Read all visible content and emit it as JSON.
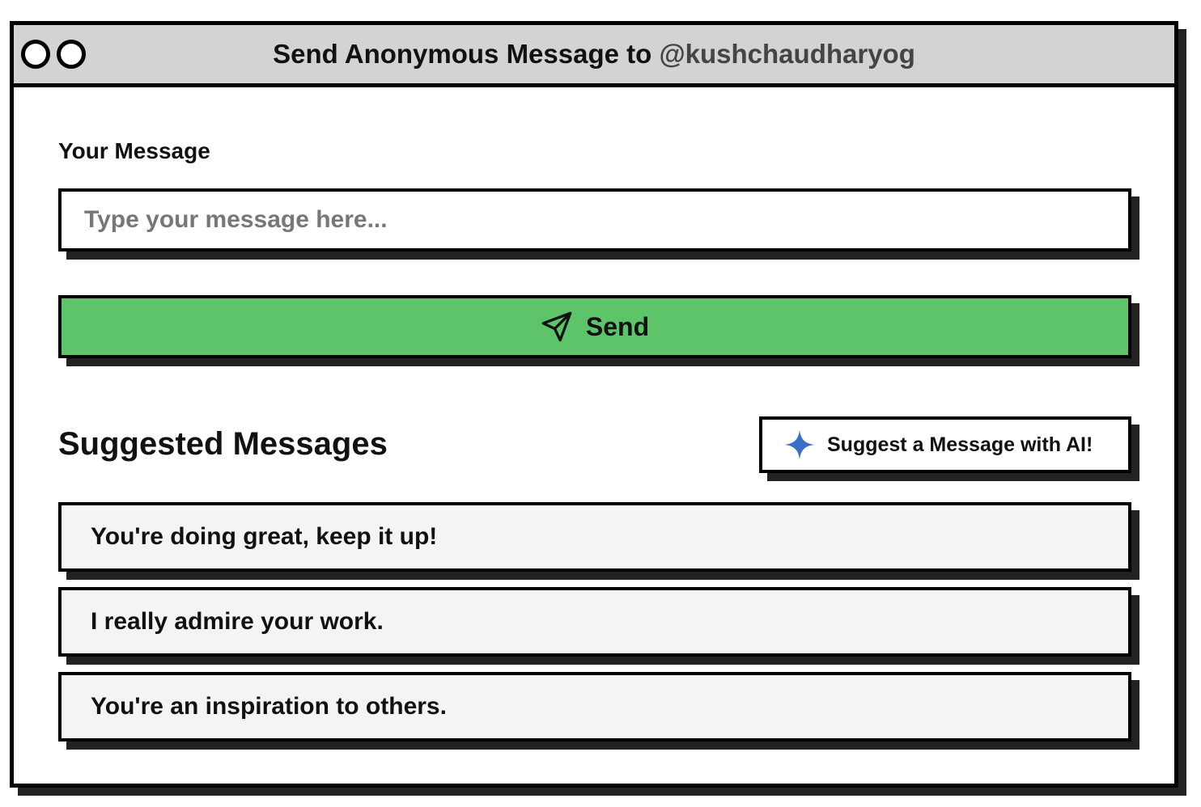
{
  "window": {
    "title_prefix": "Send Anonymous Message to ",
    "title_handle": "@kushchaudharyog"
  },
  "form": {
    "label": "Your Message",
    "input_value": "",
    "input_placeholder": "Type your message here...",
    "send_label": "Send",
    "send_icon": "paper-plane-icon"
  },
  "suggestions": {
    "title": "Suggested Messages",
    "ai_button_label": "Suggest a Message with AI!",
    "ai_icon": "sparkle-icon",
    "items": [
      "You're doing great, keep it up!",
      "I really admire your work.",
      "You're an inspiration to others."
    ]
  },
  "colors": {
    "send_button": "#5ec46a",
    "sparkle": "#3a6fc9",
    "titlebar": "#d3d3d3",
    "suggestion_bg": "#f4f4f4"
  }
}
